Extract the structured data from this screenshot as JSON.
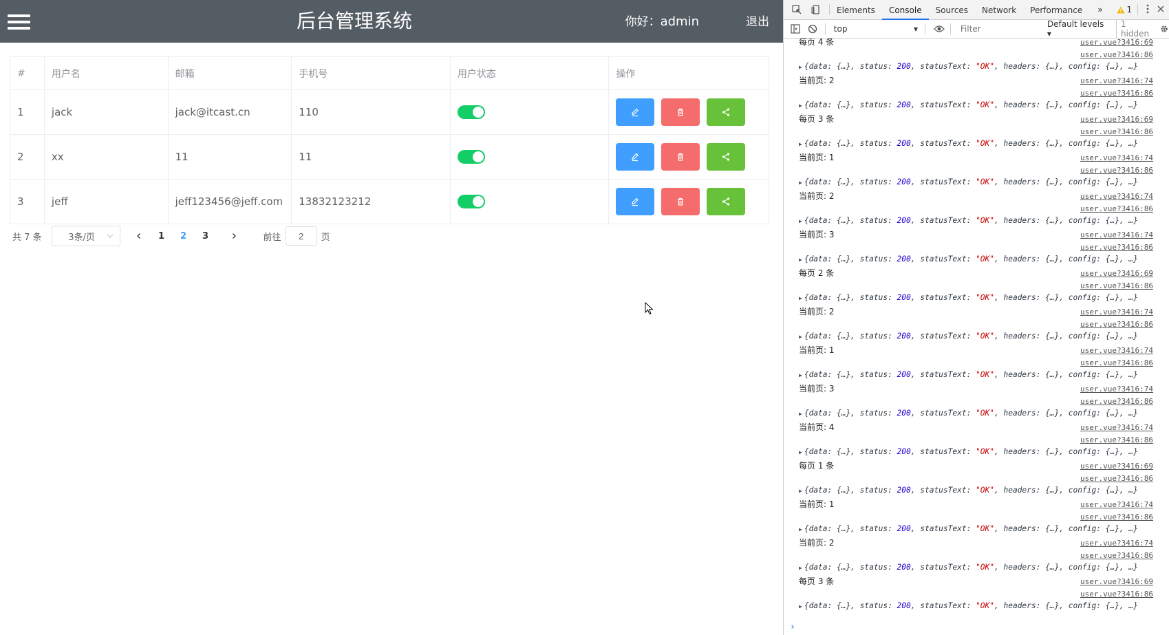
{
  "app": {
    "title": "后台管理系统",
    "greeting_prefix": "你好：",
    "username": "admin",
    "logout": "退出"
  },
  "table": {
    "headers": [
      "#",
      "用户名",
      "邮箱",
      "手机号",
      "用户状态",
      "操作"
    ],
    "rows": [
      {
        "index": "1",
        "username": "jack",
        "email": "jack@itcast.cn",
        "phone": "110",
        "status_on": true
      },
      {
        "index": "2",
        "username": "xx",
        "email": "11",
        "phone": "11",
        "status_on": true
      },
      {
        "index": "3",
        "username": "jeff",
        "email": "jeff123456@jeff.com",
        "phone": "13832123212",
        "status_on": true
      }
    ]
  },
  "pagination": {
    "total": "共 7 条",
    "page_size": "3条/页",
    "pages": [
      "1",
      "2",
      "3"
    ],
    "current_page": "2",
    "goto_label": "前往",
    "goto_value": "2",
    "page_suffix": "页"
  },
  "devtools": {
    "tabs": [
      "Elements",
      "Console",
      "Sources",
      "Network",
      "Performance"
    ],
    "active_tab": "Console",
    "more_tabs": "»",
    "warnings": "1",
    "context": "top",
    "filter_placeholder": "Filter",
    "levels": "Default levels",
    "hidden": "1 hidden",
    "logs": [
      {
        "msg": "每页 4 条",
        "src1": "user.vue?3416:69",
        "src2": "user.vue?3416:86"
      },
      {
        "msg": "当前页: 2",
        "src1": "user.vue?3416:74",
        "src2": "user.vue?3416:86"
      },
      {
        "msg": "每页 3 条",
        "src1": "user.vue?3416:69",
        "src2": "user.vue?3416:86"
      },
      {
        "msg": "当前页: 1",
        "src1": "user.vue?3416:74",
        "src2": "user.vue?3416:86"
      },
      {
        "msg": "当前页: 2",
        "src1": "user.vue?3416:74",
        "src2": "user.vue?3416:86"
      },
      {
        "msg": "当前页: 3",
        "src1": "user.vue?3416:74",
        "src2": "user.vue?3416:86"
      },
      {
        "msg": "每页 2 条",
        "src1": "user.vue?3416:69",
        "src2": "user.vue?3416:86"
      },
      {
        "msg": "当前页: 2",
        "src1": "user.vue?3416:74",
        "src2": "user.vue?3416:86"
      },
      {
        "msg": "当前页: 1",
        "src1": "user.vue?3416:74",
        "src2": "user.vue?3416:86"
      },
      {
        "msg": "当前页: 3",
        "src1": "user.vue?3416:74",
        "src2": "user.vue?3416:86"
      },
      {
        "msg": "当前页: 4",
        "src1": "user.vue?3416:74",
        "src2": "user.vue?3416:86"
      },
      {
        "msg": "每页 1 条",
        "src1": "user.vue?3416:69",
        "src2": "user.vue?3416:86"
      },
      {
        "msg": "当前页: 1",
        "src1": "user.vue?3416:74",
        "src2": "user.vue?3416:86"
      },
      {
        "msg": "当前页: 2",
        "src1": "user.vue?3416:74",
        "src2": "user.vue?3416:86"
      },
      {
        "msg": "每页 3 条",
        "src1": "user.vue?3416:69",
        "src2": "user.vue?3416:86"
      }
    ],
    "object_line": {
      "p1": "{data: {…}, status: ",
      "status": "200",
      "p2": ", statusText: ",
      "status_text": "\"OK\"",
      "p3": ", headers: {…}, config: {…}, …}"
    },
    "prompt": "›"
  },
  "colors": {
    "header_bg": "#545c64",
    "edit": "#409eff",
    "delete": "#f56c6c",
    "share": "#67c23a",
    "switch_on": "#13ce66"
  }
}
